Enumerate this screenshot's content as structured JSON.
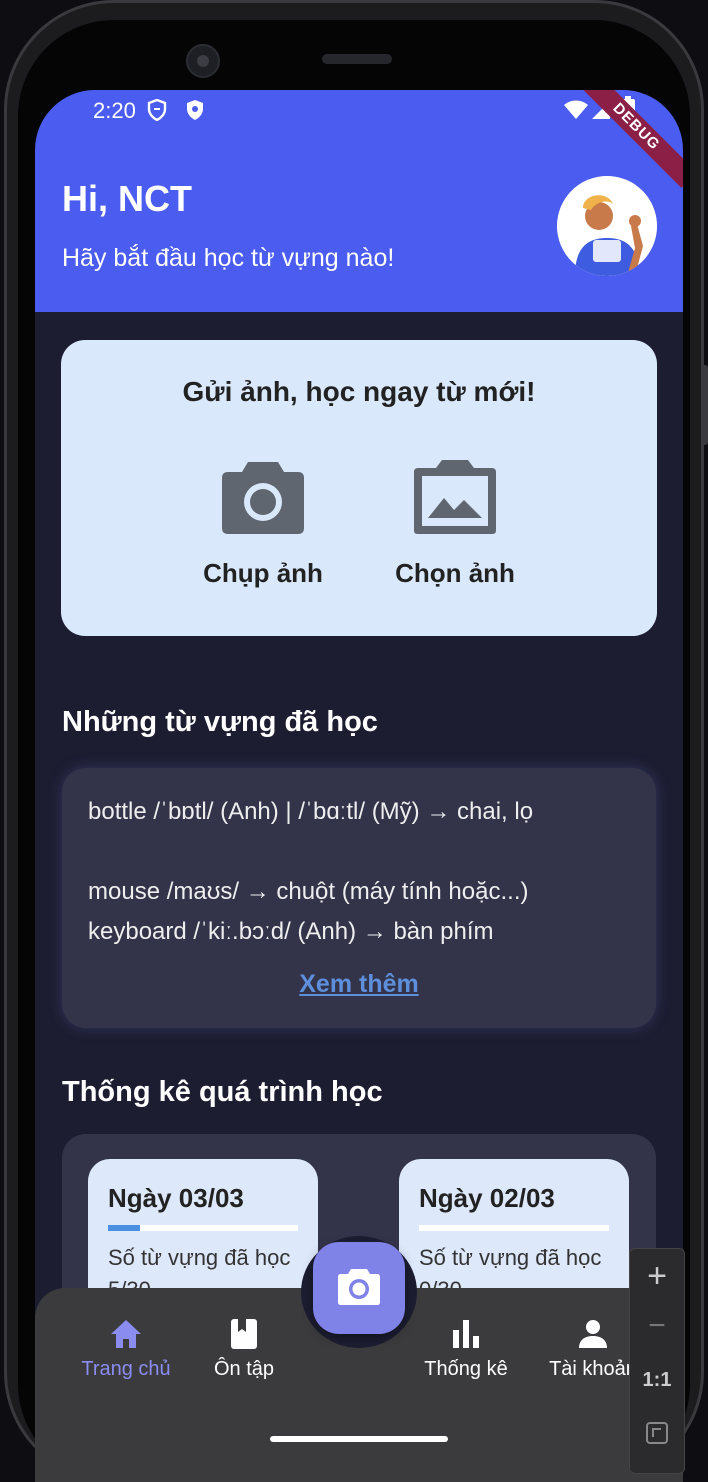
{
  "status_bar": {
    "time": "2:20",
    "debug_label": "DEBUG"
  },
  "header": {
    "greeting": "Hi, NCT",
    "subtitle": "Hãy bắt đầu học từ vựng nào!"
  },
  "upload": {
    "title": "Gửi ảnh, học ngay từ mới!",
    "take_photo_label": "Chụp ảnh",
    "choose_photo_label": "Chọn ảnh"
  },
  "vocab": {
    "section_title": "Những từ vựng đã học",
    "lines": [
      "bottle /ˈbɒtl/ (Anh) | /ˈbɑːtl/ (Mỹ) → chai, lọ",
      "mouse /maʊs/ → chuột (máy tính hoặc...)",
      "keyboard /ˈkiː.bɔːd/ (Anh) → bàn phím"
    ],
    "see_more": "Xem thêm"
  },
  "stats": {
    "section_title": "Thống kê quá trình học",
    "days": [
      {
        "title": "Ngày 03/03",
        "label": "Số từ vựng đã học",
        "count": "5/30",
        "progress": 0.167
      },
      {
        "title": "Ngày 02/03",
        "label": "Số từ vựng đã học",
        "count": "0/30",
        "progress": 0
      }
    ]
  },
  "nav": {
    "items": [
      {
        "label": "Trang chủ",
        "icon": "home-icon",
        "active": true
      },
      {
        "label": "Ôn tập",
        "icon": "book-icon",
        "active": false
      },
      {
        "label": "Thống kê",
        "icon": "bar-chart-icon",
        "active": false
      },
      {
        "label": "Tài khoản",
        "icon": "person-icon",
        "active": false
      }
    ],
    "fab_icon": "camera-icon"
  },
  "zoom_controls": {
    "plus": "+",
    "minus": "−",
    "reset": "1:1"
  },
  "colors": {
    "header_bg": "#4b5cf0",
    "screen_bg": "#1c1d31",
    "card_light": "#d9e8fb",
    "card_dark": "#33344a",
    "accent": "#7f82e6",
    "link": "#5d8fdc"
  }
}
